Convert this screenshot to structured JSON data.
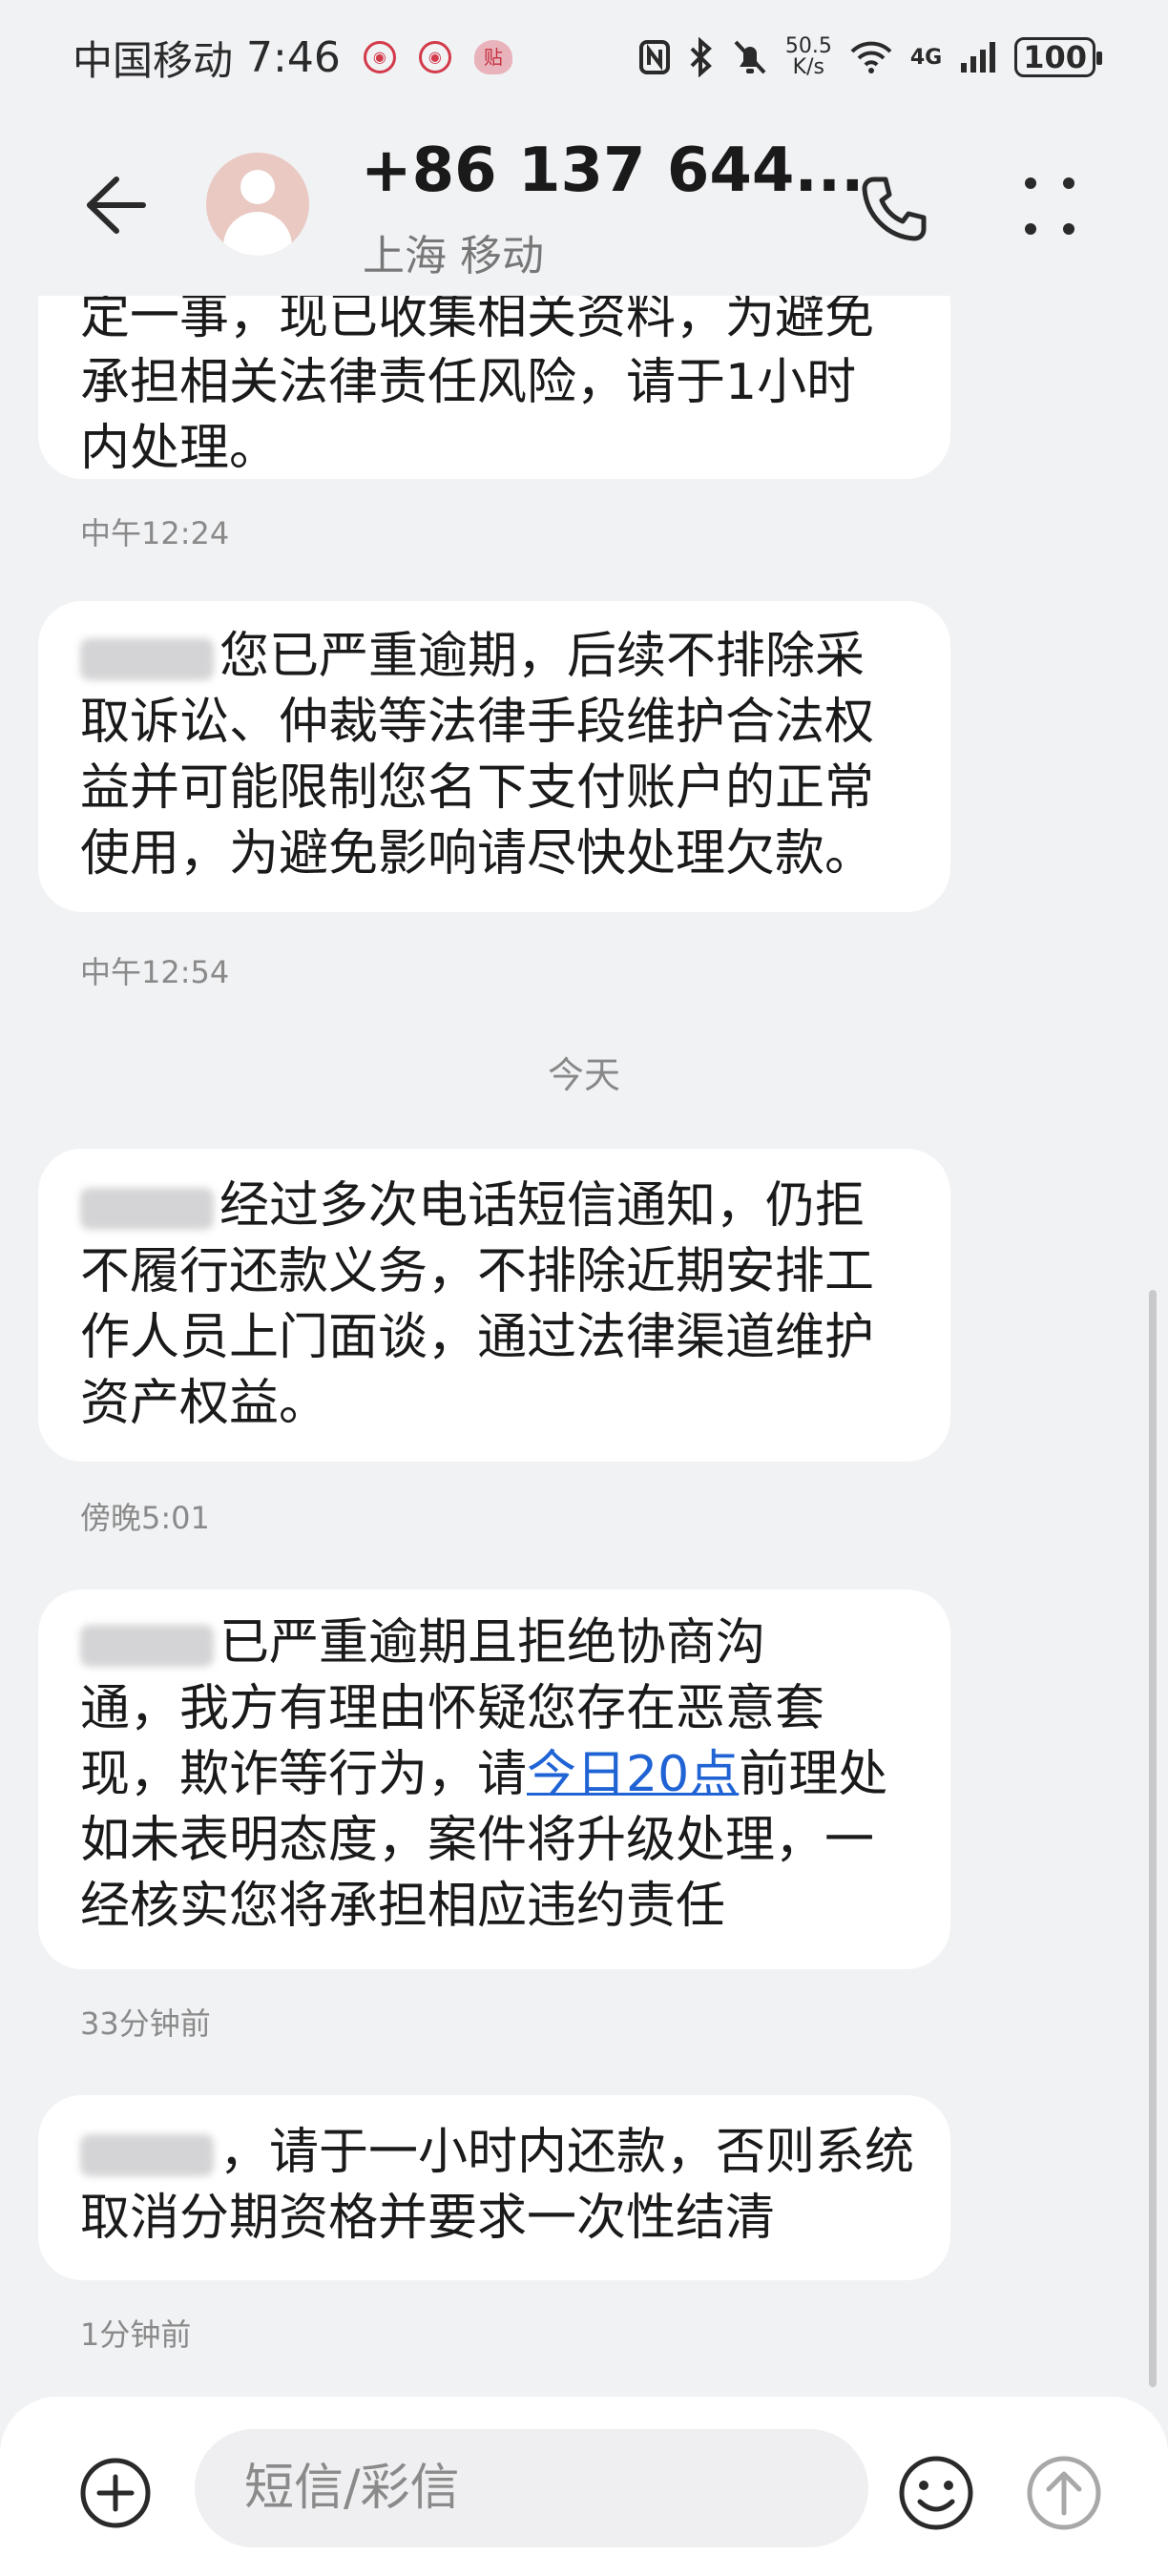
{
  "status_bar": {
    "carrier": "中国移动",
    "time": "7:46",
    "notif_badge": "贴",
    "net_speed_value": "50.5",
    "net_speed_unit": "K/s",
    "network": "4G",
    "battery": "100"
  },
  "header": {
    "contact_name": "+86 137 644...",
    "contact_location": "上海 移动"
  },
  "messages": [
    {
      "lines": [
        "定一事，现已收集相关资料，为避免",
        "承担相关法律责任风险，请于1小时",
        "内处理。"
      ],
      "time": "中午12:24"
    },
    {
      "lines": [
        "您已严重逾期，后续不排除采",
        "取诉讼、仲裁等法律手段维护合法权",
        "益并可能限制您名下支付账户的正常",
        "使用，为避免影响请尽快处理欠款。"
      ],
      "time": "中午12:54"
    },
    {
      "day_separator": "今天",
      "lines": [
        "经过多次电话短信通知，仍拒",
        "不履行还款义务，不排除近期安排工",
        "作人员上门面谈，通过法律渠道维护",
        "资产权益。"
      ],
      "time": "傍晚5:01"
    },
    {
      "lines": [
        "已严重逾期且拒绝协商沟",
        "通，我方有理由怀疑您存在恶意套",
        "现，欺诈等行为，请",
        "前理处",
        "如未表明态度，案件将升级处理，一",
        "经核实您将承担相应违约责任"
      ],
      "link_text": "今日20点",
      "time": "33分钟前"
    },
    {
      "lines": [
        "，请于一小时内还款，否则系统",
        "取消分期资格并要求一次性结清"
      ],
      "time": "1分钟前"
    }
  ],
  "composer": {
    "placeholder": "短信/彩信"
  },
  "icons": {
    "back": "arrow-left-icon",
    "phone": "phone-icon",
    "more": "more-vertical-icon",
    "add": "plus-circle-icon",
    "emoji": "smiley-icon",
    "send": "arrow-up-circle-icon"
  },
  "colors": {
    "background": "#f1f2f4",
    "bubble": "#ffffff",
    "link": "#1f63d4",
    "avatar": "#e9c9c2"
  }
}
